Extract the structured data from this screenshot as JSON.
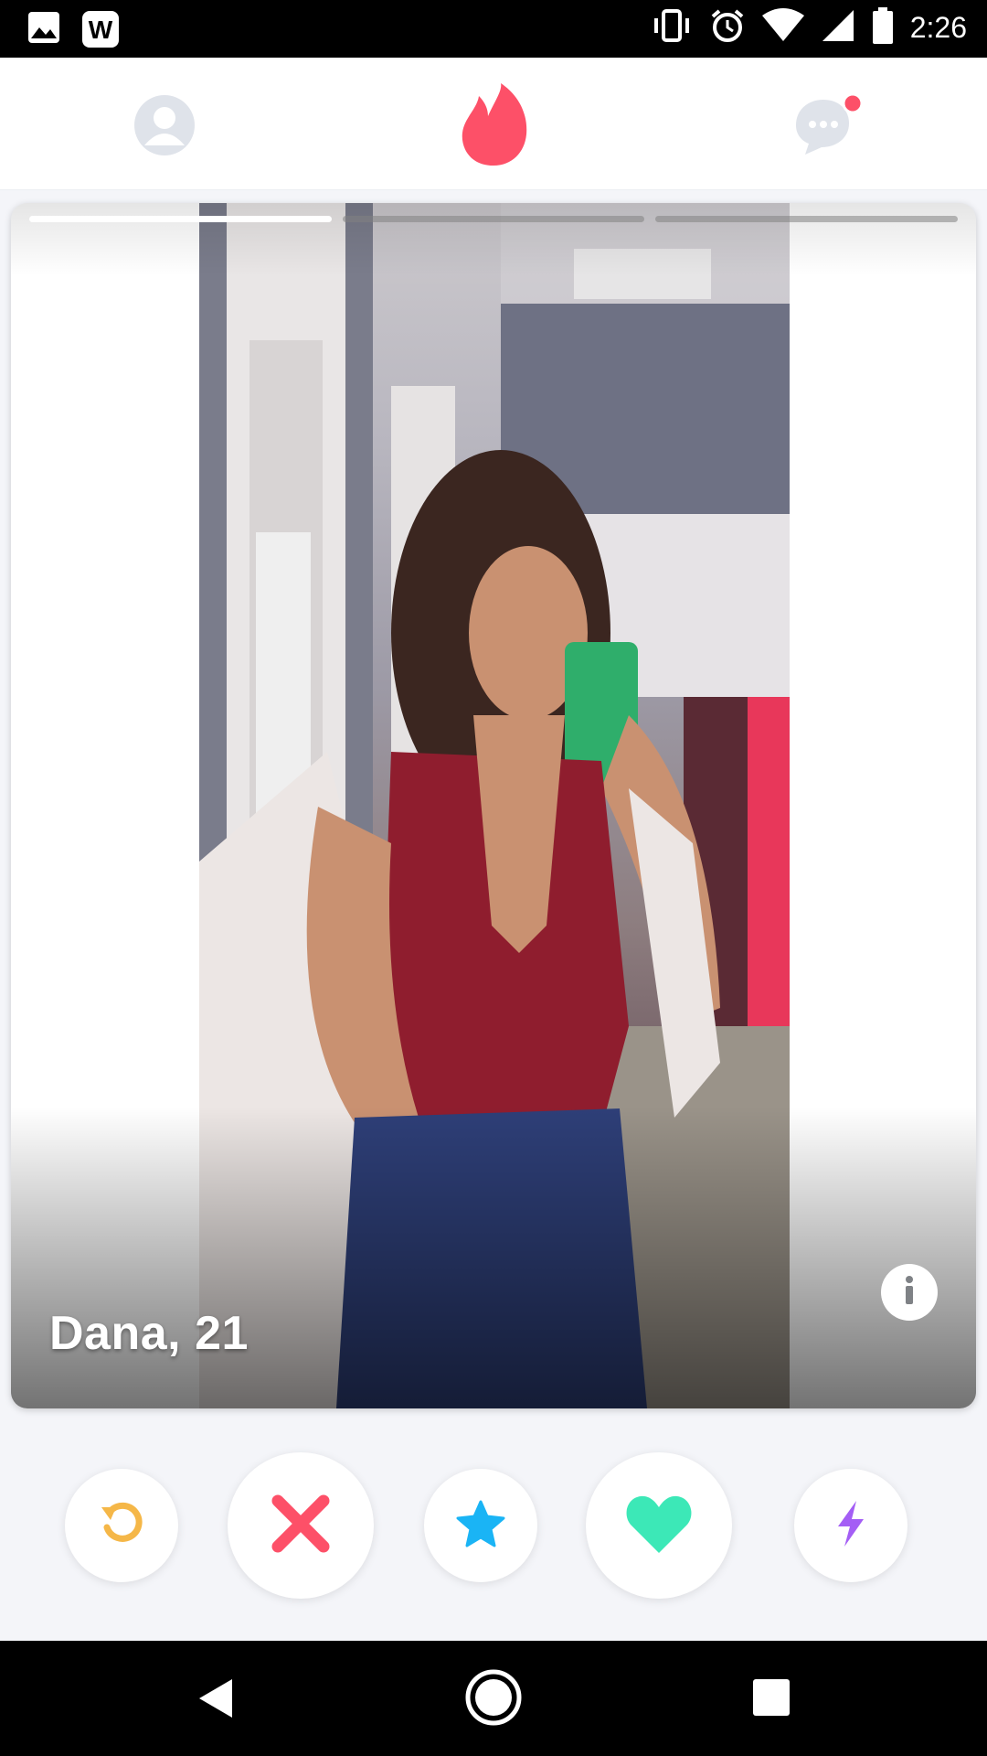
{
  "status_bar": {
    "time": "2:26",
    "left_icons": [
      "image-icon",
      "w-app-icon"
    ],
    "right_icons": [
      "vibrate-icon",
      "alarm-icon",
      "wifi-icon",
      "signal-icon",
      "battery-icon"
    ]
  },
  "top_nav": {
    "items": [
      "profile-icon",
      "flame-icon",
      "messages-icon"
    ],
    "accent": "#fd5068"
  },
  "card": {
    "name": "Dana,",
    "age": "21",
    "photo_count": 3,
    "active_photo": 1
  },
  "actions": {
    "rewind_color": "#f5b748",
    "nope_color": "#fd5068",
    "super_like_color": "#1ab4f5",
    "like_color": "#3ce8b7",
    "boost_color": "#a45ef5"
  },
  "system_nav": [
    "back-icon",
    "home-icon",
    "recents-icon"
  ]
}
